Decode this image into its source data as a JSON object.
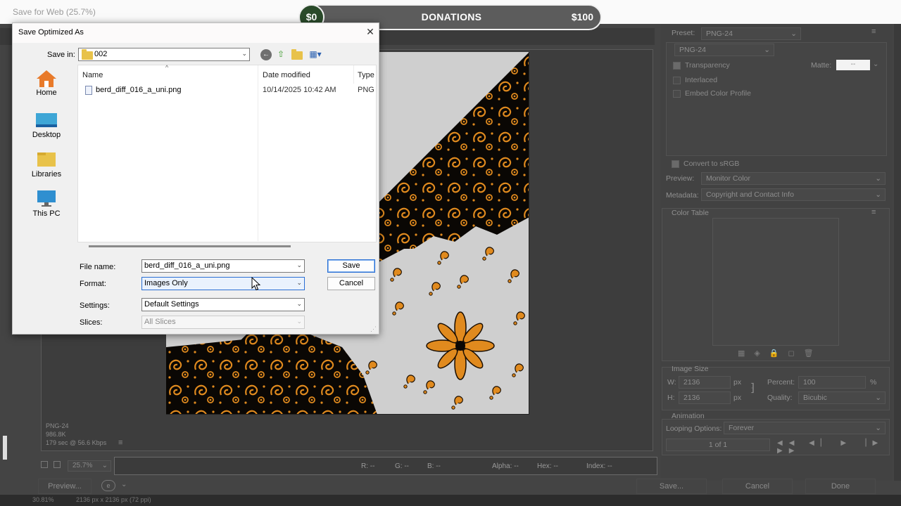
{
  "sfw": {
    "title": "Save for Web (25.7%)",
    "info": {
      "format": "PNG-24",
      "size": "986.8K",
      "time": "179 sec @ 56.6 Kbps"
    },
    "zoom": "25.7%",
    "readouts": {
      "r": "R: --",
      "g": "G: --",
      "b": "B: --",
      "alpha": "Alpha: --",
      "hex": "Hex: --",
      "index": "Index: --"
    },
    "buttons": {
      "preview": "Preview...",
      "save": "Save...",
      "cancel": "Cancel",
      "done": "Done"
    },
    "status": {
      "zoom": "30.81%",
      "dims": "2136 px x 2136 px (72 ppi)"
    }
  },
  "right_panel": {
    "preset_label": "Preset:",
    "preset_value": "PNG-24",
    "format_value": "PNG-24",
    "transparency": "Transparency",
    "matte_label": "Matte:",
    "matte_value": "--",
    "interlaced": "Interlaced",
    "embed_profile": "Embed Color Profile",
    "convert_srgb": "Convert to sRGB",
    "preview_label": "Preview:",
    "preview_value": "Monitor Color",
    "metadata_label": "Metadata:",
    "metadata_value": "Copyright and Contact Info",
    "color_table": "Color Table",
    "image_size": "Image Size",
    "w_label": "W:",
    "w_value": "2136",
    "h_label": "H:",
    "h_value": "2136",
    "px": "px",
    "percent_label": "Percent:",
    "percent_value": "100",
    "percent_unit": "%",
    "quality_label": "Quality:",
    "quality_value": "Bicubic",
    "animation": "Animation",
    "looping_label": "Looping Options:",
    "looping_value": "Forever",
    "frame_counter": "1 of 1"
  },
  "donations": {
    "current": "$0",
    "title": "DONATIONS",
    "goal": "$100"
  },
  "dialog": {
    "title": "Save Optimized As",
    "save_in_label": "Save in:",
    "save_in_value": "002",
    "places": [
      "Home",
      "Desktop",
      "Libraries",
      "This PC"
    ],
    "columns": {
      "name": "Name",
      "date": "Date modified",
      "type": "Type"
    },
    "files": [
      {
        "name": "berd_diff_016_a_uni.png",
        "date": "10/14/2025 10:42 AM",
        "type": "PNG"
      }
    ],
    "filename_label": "File name:",
    "filename_value": "berd_diff_016_a_uni.png",
    "format_label": "Format:",
    "format_value": "Images Only",
    "settings_label": "Settings:",
    "settings_value": "Default Settings",
    "slices_label": "Slices:",
    "slices_value": "All Slices",
    "save_button": "Save",
    "cancel_button": "Cancel"
  }
}
